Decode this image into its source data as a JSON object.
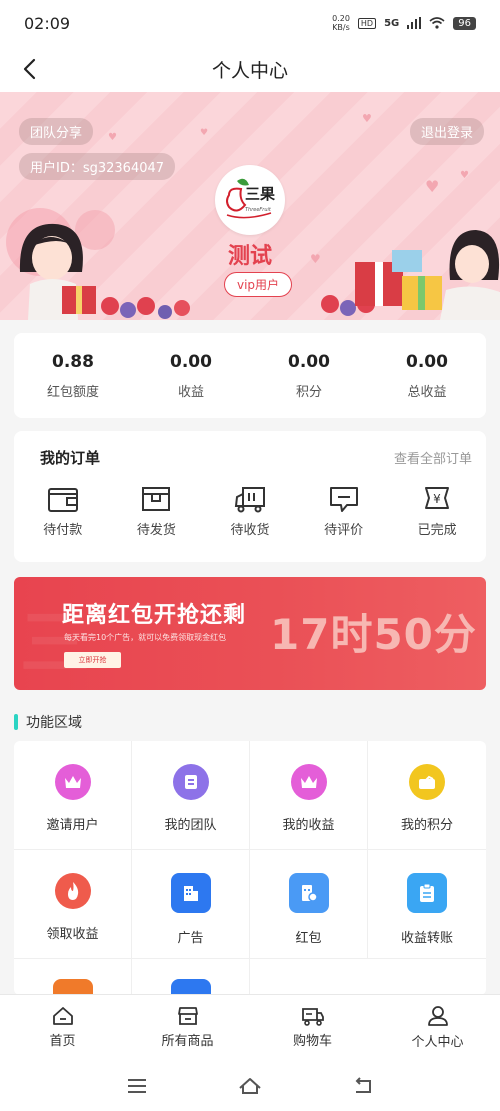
{
  "status_bar": {
    "time": "02:09",
    "net_speed_value": "0.20",
    "net_speed_unit": "KB/s",
    "hd": "HD",
    "network": "5G",
    "battery": "96"
  },
  "nav": {
    "title": "个人中心",
    "back_icon": "chevron-left-icon"
  },
  "profile": {
    "team_share": "团队分享",
    "user_id": "用户ID：sg32364047",
    "logout": "退出登录",
    "logo_text": "三果",
    "logo_subtext": "ThreeFruit",
    "username": "测试",
    "vip_badge": "vip用户",
    "accent_color": "#e3424f"
  },
  "stats": [
    {
      "value": "0.88",
      "label": "红包额度"
    },
    {
      "value": "0.00",
      "label": "收益"
    },
    {
      "value": "0.00",
      "label": "积分"
    },
    {
      "value": "0.00",
      "label": "总收益"
    }
  ],
  "orders": {
    "title": "我的订单",
    "view_all": "查看全部订单",
    "items": [
      {
        "label": "待付款",
        "icon": "wallet-icon"
      },
      {
        "label": "待发货",
        "icon": "package-icon"
      },
      {
        "label": "待收货",
        "icon": "truck-icon"
      },
      {
        "label": "待评价",
        "icon": "comment-icon"
      },
      {
        "label": "已完成",
        "icon": "completed-icon"
      }
    ]
  },
  "promo": {
    "title": "距离红包开抢还剩",
    "subtitle": "每天看完10个广告，就可以免费领取现金红包",
    "button": "立即开抢",
    "countdown": "17时50分"
  },
  "features": {
    "title": "功能区域",
    "items": [
      {
        "label": "邀请用户",
        "icon": "crown-icon",
        "color": "#e45ed8"
      },
      {
        "label": "我的团队",
        "icon": "team-icon",
        "color": "#8d72e8"
      },
      {
        "label": "我的收益",
        "icon": "crown-icon",
        "color": "#e45ed8"
      },
      {
        "label": "我的积分",
        "icon": "points-icon",
        "color": "#f2c61f"
      },
      {
        "label": "领取收益",
        "icon": "flame-icon",
        "color": "#ef5b4c"
      },
      {
        "label": "广告",
        "icon": "building-icon",
        "color": "#2d78f0"
      },
      {
        "label": "红包",
        "icon": "redpacket-icon",
        "color": "#4a9af5"
      },
      {
        "label": "收益转账",
        "icon": "clipboard-icon",
        "color": "#3aa6f3"
      }
    ],
    "partial_row_colors": [
      "#f07a2a",
      "#2d78f0"
    ]
  },
  "tabs": [
    {
      "label": "首页",
      "icon": "home-icon"
    },
    {
      "label": "所有商品",
      "icon": "shop-icon"
    },
    {
      "label": "购物车",
      "icon": "cart-icon"
    },
    {
      "label": "个人中心",
      "icon": "user-icon"
    }
  ],
  "system_nav": [
    "menu-icon",
    "home-outline-icon",
    "back-icon"
  ]
}
